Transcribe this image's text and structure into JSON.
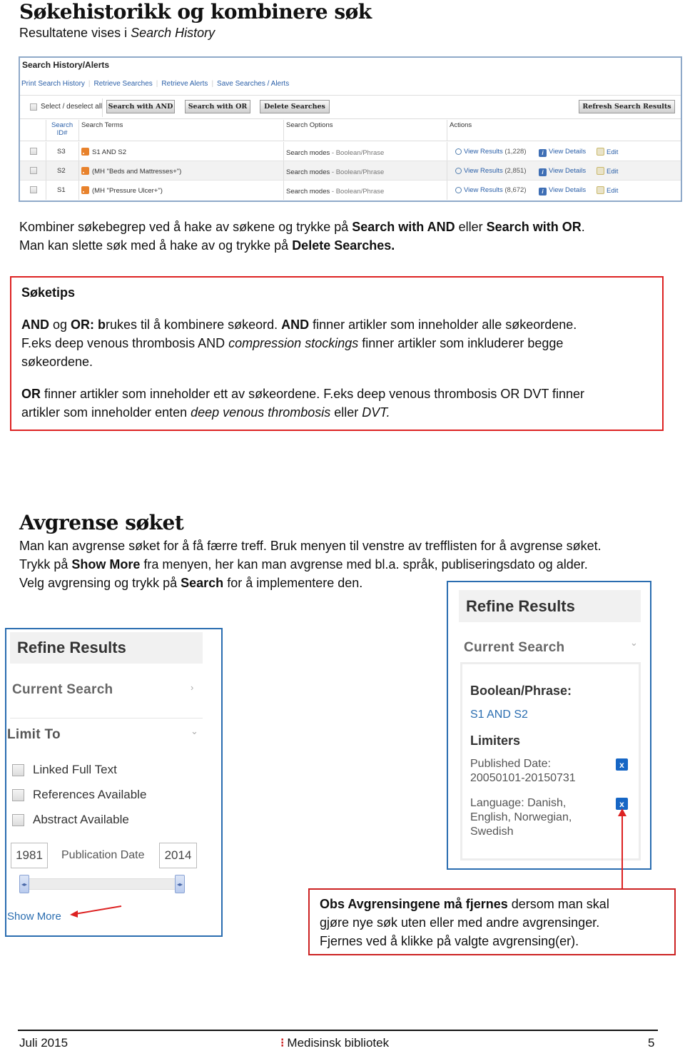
{
  "section1": {
    "title": "Søkehistorikk og kombinere søk",
    "subtitle_prefix": "Resultatene vises i ",
    "subtitle_em": "Search History"
  },
  "search_history": {
    "title": "Search History/Alerts",
    "links": [
      "Print Search History",
      "Retrieve Searches",
      "Retrieve Alerts",
      "Save Searches / Alerts"
    ],
    "select_all_label": "Select / deselect all",
    "buttons": {
      "search_and": "Search with AND",
      "search_or": "Search with OR",
      "delete": "Delete Searches",
      "refresh": "Refresh Search Results"
    },
    "columns": {
      "id_line1": "Search",
      "id_line2": "ID#",
      "terms": "Search Terms",
      "options": "Search Options",
      "actions": "Actions"
    },
    "rows": [
      {
        "id": "S3",
        "terms": "S1 AND S2",
        "option_label": "Search modes",
        "option_value": " - Boolean/Phrase",
        "view_results": "View Results",
        "count": "(1,228)",
        "view_details": "View Details",
        "edit": "Edit"
      },
      {
        "id": "S2",
        "terms": "(MH \"Beds and Mattresses+\")",
        "option_label": "Search modes",
        "option_value": " - Boolean/Phrase",
        "view_results": "View Results",
        "count": "(2,851)",
        "view_details": "View Details",
        "edit": "Edit"
      },
      {
        "id": "S1",
        "terms": "(MH \"Pressure Ulcer+\")",
        "option_label": "Search modes",
        "option_value": " - Boolean/Phrase",
        "view_results": "View Results",
        "count": "(8,672)",
        "view_details": "View Details",
        "edit": "Edit"
      }
    ]
  },
  "combine_text": {
    "line1_a": "Kombiner søkebegrep ved å hake av søkene og trykke på ",
    "line1_b": "Search with AND",
    "line1_c": " eller ",
    "line1_d": "Search with OR",
    "line1_e": ".",
    "line2_a": "Man kan slette søk med å hake av og trykke på ",
    "line2_b": "Delete Searches."
  },
  "tips": {
    "heading": "Søketips",
    "p1_and": "AND",
    "p1_og": " og ",
    "p1_or": "OR: b",
    "p1_rest": "rukes til å kombinere søkeord. ",
    "p1_and2": "AND",
    "p1_rest2": " finner artikler som inneholder alle søkeordene.",
    "p1_l2a": "F.eks deep venous thrombosis AND ",
    "p1_l2em": "compression stockings",
    "p1_l2b": " finner artikler som inkluderer begge",
    "p1_l3": "søkeordene.",
    "p2_or": "OR",
    "p2_rest": " finner artikler som inneholder ett av søkeordene. F.eks deep venous thrombosis OR DVT finner",
    "p2_l2a": "artikler som inneholder enten ",
    "p2_l2em": "deep venous thrombosis",
    "p2_l2b": " eller ",
    "p2_l2em2": "DVT."
  },
  "section2": {
    "title": "Avgrense søket",
    "line1": "Man kan avgrense søket for å få færre treff. Bruk menyen til venstre av trefflisten for å avgrense søket.",
    "line2_a": "Trykk på ",
    "line2_b": "Show More",
    "line2_c": " fra menyen, her kan man avgrense med bl.a. språk, publiseringsdato og alder.",
    "line3_a": "Velg avgrensing og trykk på ",
    "line3_b": "Search",
    "line3_c": " for å implementere den."
  },
  "refine_left": {
    "title": "Refine Results",
    "current_search": "Current Search",
    "limit_to": "Limit To",
    "limiters": [
      "Linked Full Text",
      "References Available",
      "Abstract Available"
    ],
    "date_from": "1981",
    "date_label": "Publication Date",
    "date_to": "2014",
    "show_more": "Show More"
  },
  "refine_right": {
    "title": "Refine Results",
    "current_search": "Current Search",
    "boolean_heading": "Boolean/Phrase:",
    "boolean_value": "S1 AND S2",
    "limiters_heading": "Limiters",
    "published_label": "Published Date:",
    "published_value": "20050101-20150731",
    "language_l1": "Language: Danish,",
    "language_l2": "English, Norwegian,",
    "language_l3": "Swedish",
    "remove_icon": "x"
  },
  "note": {
    "bold": "Obs Avgrensingene må fjernes",
    "l1_rest": " dersom man skal",
    "l2": "gjøre nye søk uten eller med andre avgrensinger.",
    "l3": "Fjernes ved å klikke på valgte avgrensing(er)."
  },
  "footer": {
    "date": "Juli 2015",
    "org": "Medisinsk bibliotek",
    "page": "5"
  },
  "colors": {
    "link": "#2a5fa8",
    "highlight_border": "#d22222",
    "panel_border": "#2a6db0",
    "remove_button": "#1666c5"
  }
}
